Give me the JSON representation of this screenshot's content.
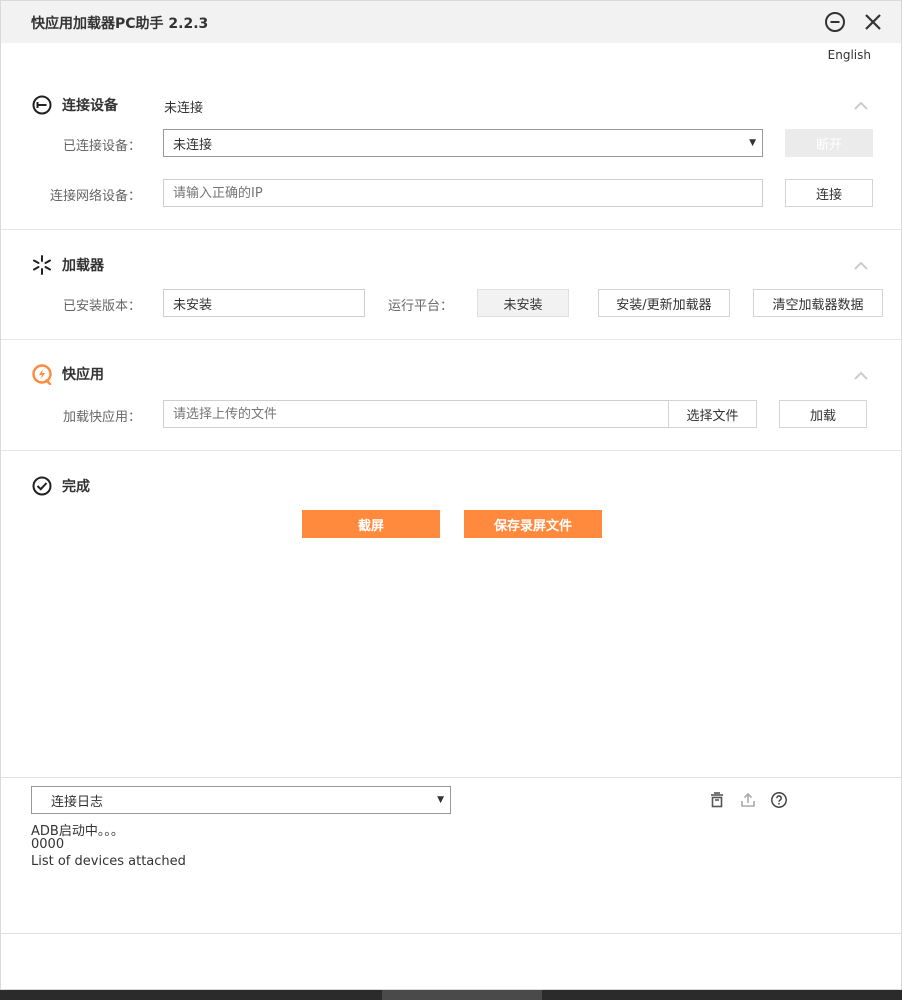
{
  "window": {
    "title": "快应用加载器PC助手 2.2.3",
    "language_link": "English"
  },
  "device": {
    "title": "连接设备",
    "status": "未连接",
    "connected_label": "已连接设备：",
    "connected_value": "未连接",
    "disconnect_button": "断开",
    "network_label": "连接网络设备：",
    "network_placeholder": "请输入正确的IP",
    "connect_button": "连接"
  },
  "loader": {
    "title": "加载器",
    "version_label": "已安装版本：",
    "version_value": "未安装",
    "platform_label": "运行平台：",
    "platform_value": "未安装",
    "install_button": "安装/更新加载器",
    "clear_button": "清空加载器数据"
  },
  "quickapp": {
    "title": "快应用",
    "load_label": "加载快应用：",
    "file_placeholder": "请选择上传的文件",
    "choose_file_button": "选择文件",
    "load_button": "加载"
  },
  "done": {
    "title": "完成",
    "screenshot_button": "截屏",
    "save_recording_button": "保存录屏文件"
  },
  "log": {
    "selected": "连接日志",
    "lines": [
      "ADB启动中。。。",
      "0000",
      "List of devices attached"
    ]
  },
  "colors": {
    "accent": "#ff8a3d",
    "titlebar": "#f2f2f2"
  },
  "icons": {
    "minimize": "minimize-circle-icon",
    "close": "close-icon",
    "device": "plug-circle-icon",
    "loader": "spinner-icon",
    "quickapp": "quickapp-logo-icon",
    "done": "check-circle-icon",
    "collapse": "chevron-up-icon",
    "clear_log": "trash-icon",
    "export_log": "upload-icon",
    "help": "help-circle-icon"
  }
}
